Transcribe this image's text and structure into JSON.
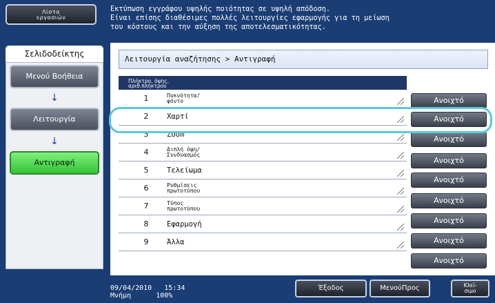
{
  "top": {
    "jobs_button_line1": "Λίστα",
    "jobs_button_line2": "εργασιών",
    "message_line1": "Εκτύπωση εγγράφου υψηλής ποιότητας σε υψηλή απόδοση.",
    "message_line2": "Είναι επίσης διαθέσιμες πολλές λειτουργίες εφαρμογής για τη μείωση",
    "message_line3": "του κόστους και την αύξηση της αποτελεσματικότητας."
  },
  "sidebar": {
    "tab_label": "Σελιδοδείκτης",
    "items": [
      {
        "label": "Μενού Βοήθεια"
      },
      {
        "label": "Λειτουργία"
      },
      {
        "label": "Αντιγραφή"
      }
    ],
    "arrow_glyph": "↓"
  },
  "main": {
    "breadcrumb": "Λειτουργία αναζήτησης > Αντιγραφή",
    "table_header_line1": "Πλήκτρο, όψης,",
    "table_header_line2": "αριθ.πλήκτρου",
    "rows": [
      {
        "num": "1",
        "name_line1": "Πυκνότητα/",
        "name_line2": "φόντο",
        "value": "Ανοιχτό"
      },
      {
        "num": "2",
        "name": "Χαρτί",
        "value": "Ανοιχτό"
      },
      {
        "num": "3",
        "name": "Zoom",
        "value": "Ανοιχτό"
      },
      {
        "num": "4",
        "name_line1": "Διπλή όψη/",
        "name_line2": "Συνδυασμός",
        "value": "Ανοιχτό"
      },
      {
        "num": "5",
        "name": "Τελείωμα",
        "value": "Ανοιχτό"
      },
      {
        "num": "6",
        "name_line1": "Ρυθμίσεις",
        "name_line2": "πρωτοτύπου",
        "value": "Ανοιχτό"
      },
      {
        "num": "7",
        "name_line1": "Τύπος",
        "name_line2": "πρωτοτύπου",
        "value": "Ανοιχτό"
      },
      {
        "num": "8",
        "name": "Εφαρμογή",
        "value": "Ανοιχτό"
      },
      {
        "num": "9",
        "name": "Άλλα",
        "value": "Ανοιχτό"
      }
    ]
  },
  "bottom": {
    "date": "09/04/2010",
    "time": "15:34",
    "memory_label": "Μνήμη",
    "memory_value": "100%",
    "exit_label": "Έξοδος",
    "menu_label": "ΜενούΠρος",
    "close_line1": "Κλεί-",
    "close_line2": "σιμο"
  },
  "colors": {
    "background": "#1a3d74",
    "active_green": "#35c335",
    "highlight": "#5cc8dd",
    "arrow": "#1d3f96"
  }
}
